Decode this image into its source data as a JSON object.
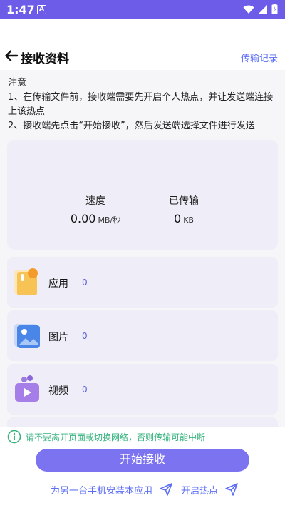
{
  "status": {
    "time": "1:47",
    "notif_glyph": "A"
  },
  "header": {
    "title": "接收资料",
    "link": "传输记录"
  },
  "notice": {
    "lines": [
      "注意",
      "1、在传输文件前，接收端需要先开启个人热点，并让发送端连接上该热点",
      "2、接收端先点击“开始接收”，然后发送端选择文件进行发送"
    ]
  },
  "stats": {
    "speed": {
      "label": "速度",
      "value": "0.00",
      "unit": "MB/秒"
    },
    "transferred": {
      "label": "已传输",
      "value": "0",
      "unit": "KB"
    }
  },
  "categories": [
    {
      "label": "应用",
      "count": "0",
      "icon": "app-icon"
    },
    {
      "label": "图片",
      "count": "0",
      "icon": "image-icon"
    },
    {
      "label": "视频",
      "count": "0",
      "icon": "video-icon"
    }
  ],
  "tip": {
    "text": "请不要离开页面或切换网络，否则传输可能中断"
  },
  "actions": {
    "start_label": "开始接收",
    "install_label": "为另一台手机安装本应用",
    "hotspot_label": "开启热点"
  },
  "colors": {
    "status_bar": "#6c5ce7",
    "accent": "#7b73f0",
    "link": "#5b6ef5",
    "tip": "#36b37e"
  }
}
